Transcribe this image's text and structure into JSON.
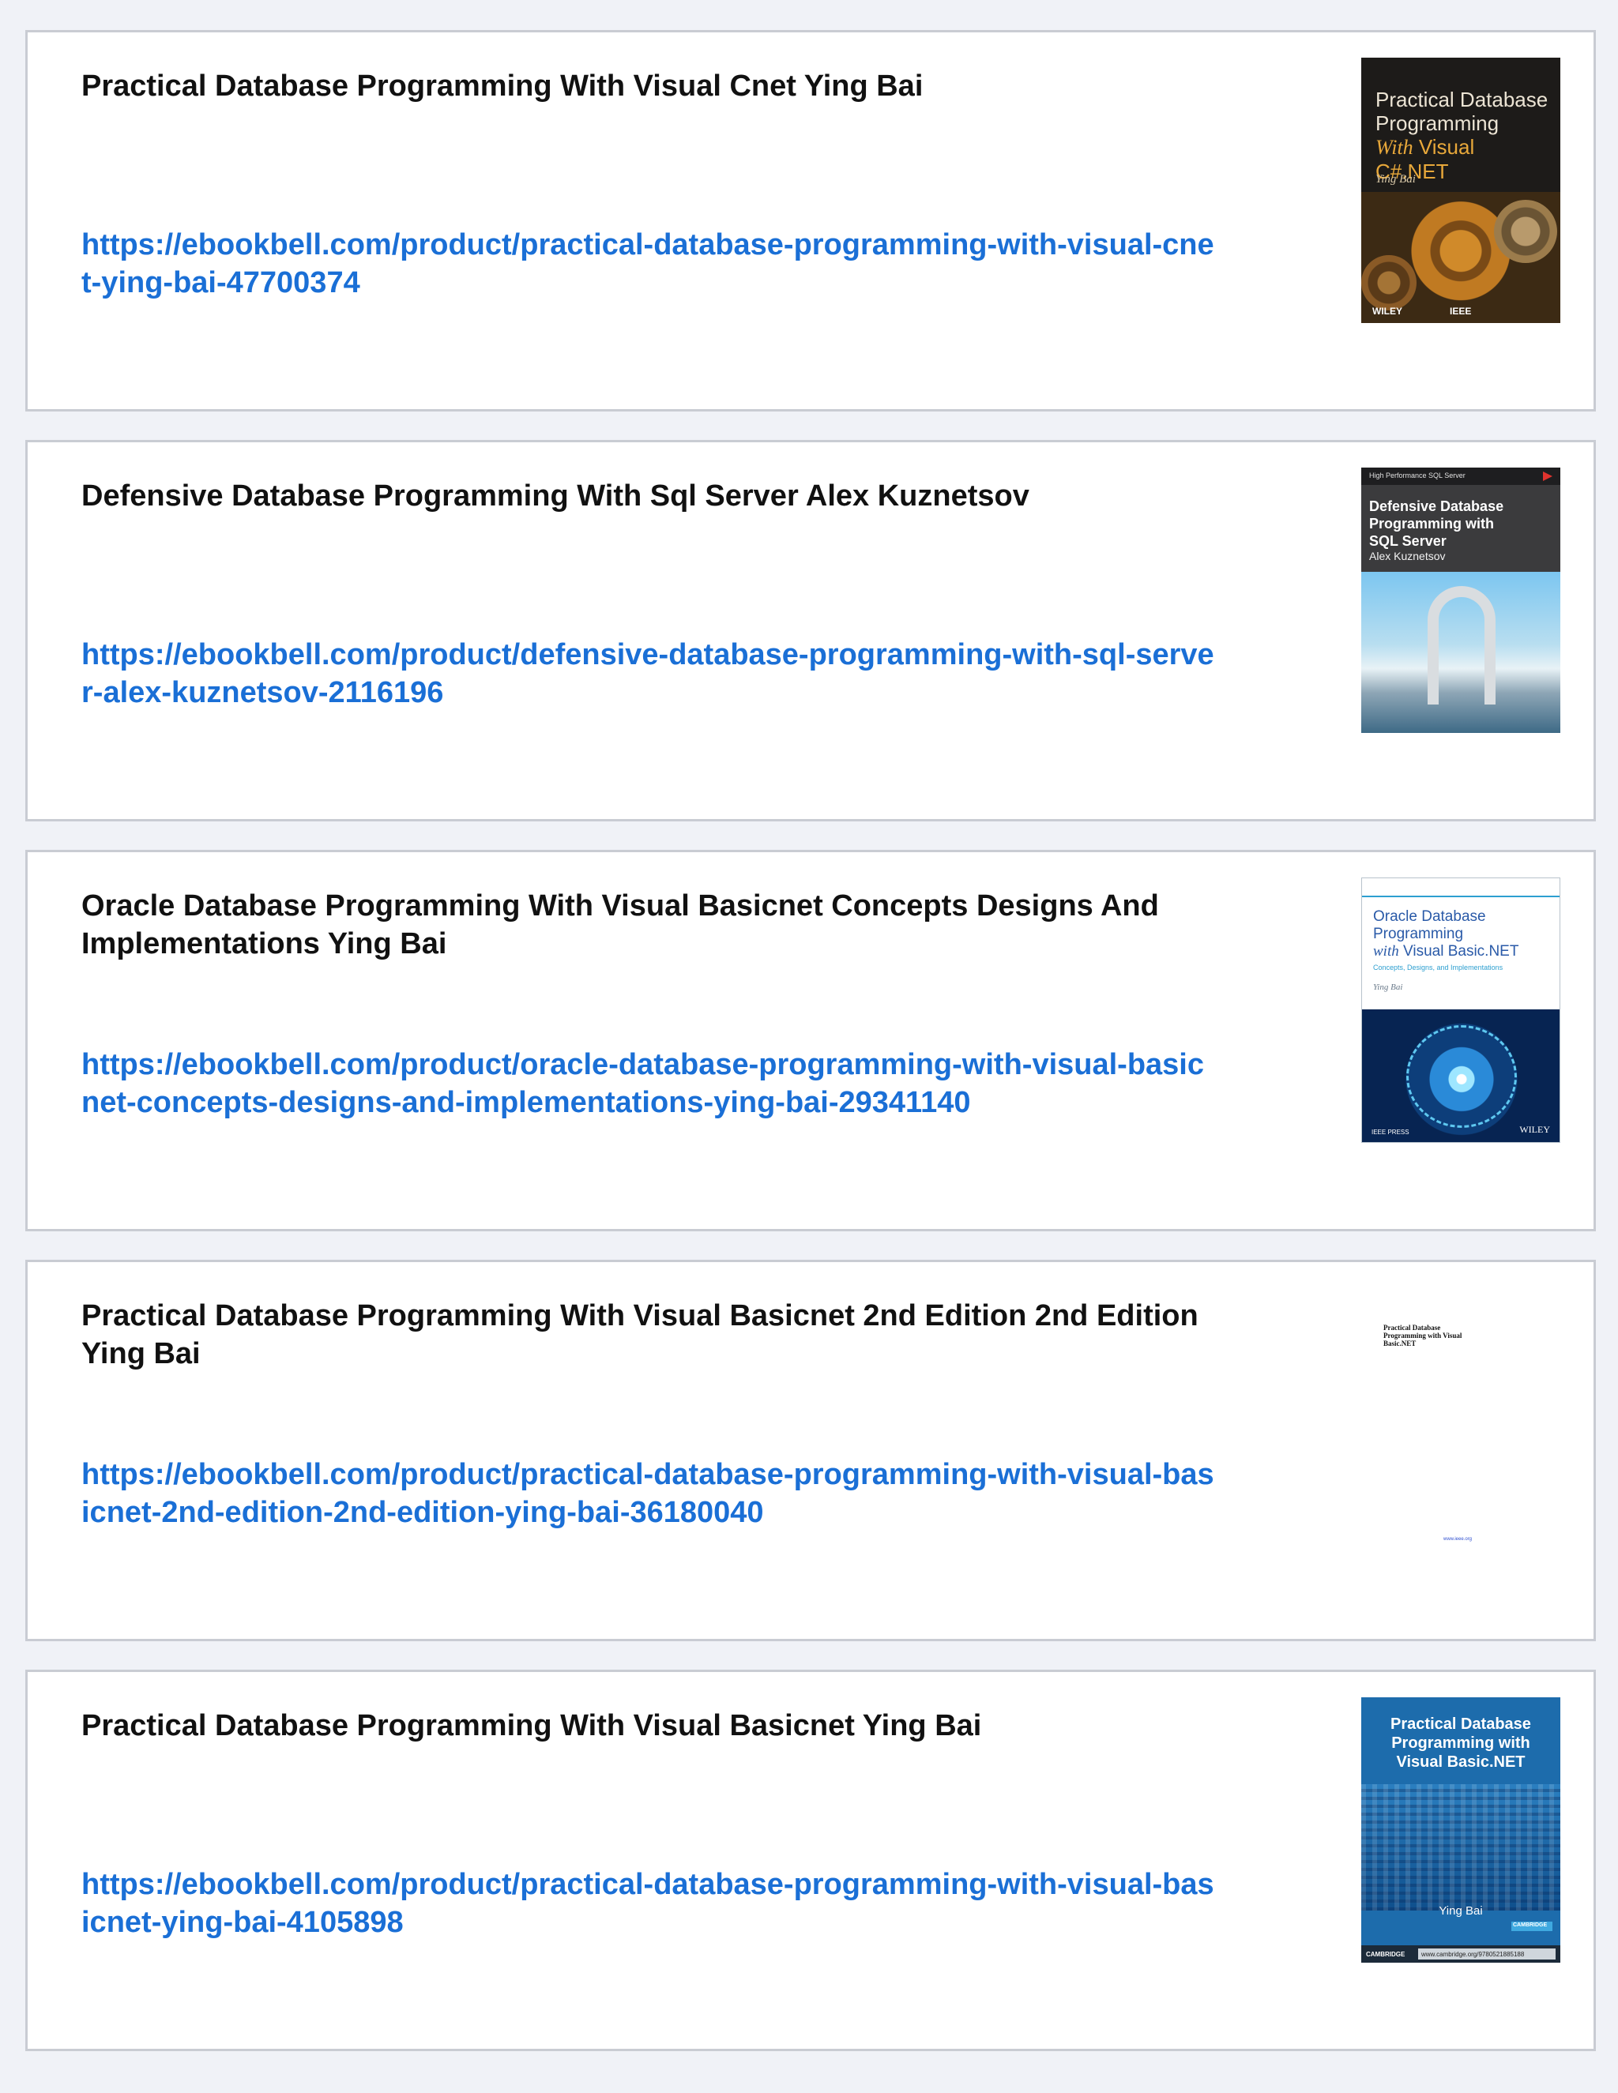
{
  "books": [
    {
      "title": "Practical Database Programming With Visual Cnet Ying Bai",
      "url": "https://ebookbell.com/product/practical-database-programming-with-visual-cnet-ying-bai-47700374",
      "cover": {
        "line1": "Practical Database",
        "line2": "Programming",
        "line3_italic": "With",
        "line3_rest": " Visual C#.NET",
        "author": "Ying Bai",
        "publisher": "WILEY",
        "publisher2": "IEEE"
      }
    },
    {
      "title": "Defensive Database Programming With Sql Server Alex Kuznetsov",
      "url": "https://ebookbell.com/product/defensive-database-programming-with-sql-server-alex-kuznetsov-2116196",
      "cover": {
        "series": "High Performance SQL Server",
        "line1": "Defensive Database",
        "line2": "Programming with",
        "line3": "SQL Server",
        "author": "Alex Kuznetsov"
      }
    },
    {
      "title": "Oracle Database Programming With Visual Basicnet Concepts Designs And Implementations Ying Bai",
      "url": "https://ebookbell.com/product/oracle-database-programming-with-visual-basicnet-concepts-designs-and-implementations-ying-bai-29341140",
      "cover": {
        "line1": "Oracle Database",
        "line2": "Programming",
        "line3_italic": "with",
        "line3_rest": " Visual Basic.NET",
        "subtitle": "Concepts, Designs, and Implementations",
        "author": "Ying Bai",
        "imprint": "IEEE PRESS",
        "publisher": "WILEY"
      }
    },
    {
      "title": "Practical Database Programming With Visual Basicnet 2nd Edition 2nd Edition Ying Bai",
      "url": "https://ebookbell.com/product/practical-database-programming-with-visual-basicnet-2nd-edition-2nd-edition-ying-bai-36180040",
      "cover": {
        "text": "Practical Database Programming with Visual Basic.NET",
        "link": "www.ieee.org"
      }
    },
    {
      "title": "Practical Database Programming With Visual Basicnet Ying Bai",
      "url": "https://ebookbell.com/product/practical-database-programming-with-visual-basicnet-ying-bai-4105898",
      "cover": {
        "line1": "Practical Database",
        "line2": "Programming with",
        "line3": "Visual Basic.NET",
        "author": "Ying Bai",
        "badge": "CAMBRIDGE",
        "footer_left": "CAMBRIDGE",
        "footer_right": "www.cambridge.org/9780521885188"
      }
    }
  ]
}
